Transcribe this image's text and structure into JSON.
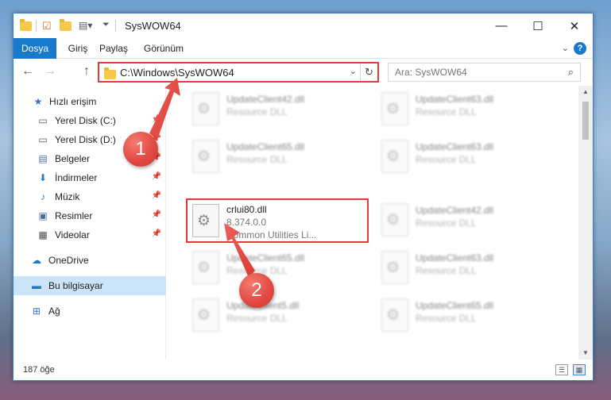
{
  "window": {
    "title": "SysWOW64",
    "controls": {
      "minimize": "—",
      "maximize": "☐",
      "close": "✕"
    }
  },
  "ribbon": {
    "tabs": [
      "Dosya",
      "Giriş",
      "Paylaş",
      "Görünüm"
    ]
  },
  "navigation": {
    "back": "←",
    "forward": "→",
    "up": "↑",
    "address": "C:\\Windows\\SysWOW64",
    "search_placeholder": "Ara: SysWOW64"
  },
  "sidebar": {
    "items": [
      {
        "label": "Hızlı erişim",
        "icon": "star-icon",
        "glyph": "★",
        "pinned": false
      },
      {
        "label": "Yerel Disk (C:)",
        "icon": "drive-icon",
        "glyph": "▭",
        "pinned": true
      },
      {
        "label": "Yerel Disk (D:)",
        "icon": "drive-icon",
        "glyph": "▭",
        "pinned": true
      },
      {
        "label": "Belgeler",
        "icon": "documents-icon",
        "glyph": "▤",
        "pinned": true
      },
      {
        "label": "İndirmeler",
        "icon": "download-icon",
        "glyph": "⬇",
        "pinned": true
      },
      {
        "label": "Müzik",
        "icon": "music-icon",
        "glyph": "♪",
        "pinned": true
      },
      {
        "label": "Resimler",
        "icon": "pictures-icon",
        "glyph": "▣",
        "pinned": true
      },
      {
        "label": "Videolar",
        "icon": "videos-icon",
        "glyph": "▦",
        "pinned": true
      },
      {
        "label": "OneDrive",
        "icon": "cloud-icon",
        "glyph": "☁",
        "pinned": false
      },
      {
        "label": "Bu bilgisayar",
        "icon": "computer-icon",
        "glyph": "▬",
        "pinned": false
      },
      {
        "label": "Ağ",
        "icon": "network-icon",
        "glyph": "⊞",
        "pinned": false
      }
    ]
  },
  "files": [
    {
      "name": "UpdateClient42.dll",
      "type": "Resource DLL",
      "blurred": true
    },
    {
      "name": "UpdateClient63.dll",
      "type": "Resource DLL",
      "blurred": true
    },
    {
      "name": "UpdateClient65.dll",
      "type": "Resource DLL",
      "blurred": true
    },
    {
      "name": "UpdateClient63.dll",
      "type": "Resource DLL",
      "blurred": true
    },
    {
      "name": "crlui80.dll",
      "version": "8.374.0.0",
      "type": "Common Utilities Li...",
      "blurred": false,
      "highlighted": true
    },
    {
      "name": "UpdateClient42.dll",
      "type": "Resource DLL",
      "blurred": true
    },
    {
      "name": "UpdateClient65.dll",
      "type": "Resource DLL",
      "blurred": true
    },
    {
      "name": "UpdateClient63.dll",
      "type": "Resource DLL",
      "blurred": true
    },
    {
      "name": "UpdateClient5.dll",
      "type": "Resource DLL",
      "blurred": true
    },
    {
      "name": "UpdateClient65.dll",
      "type": "Resource DLL",
      "blurred": true
    }
  ],
  "status": {
    "item_count": "187 öğe"
  },
  "annotations": {
    "step1": "1",
    "step2": "2",
    "color": "#e5393b"
  }
}
